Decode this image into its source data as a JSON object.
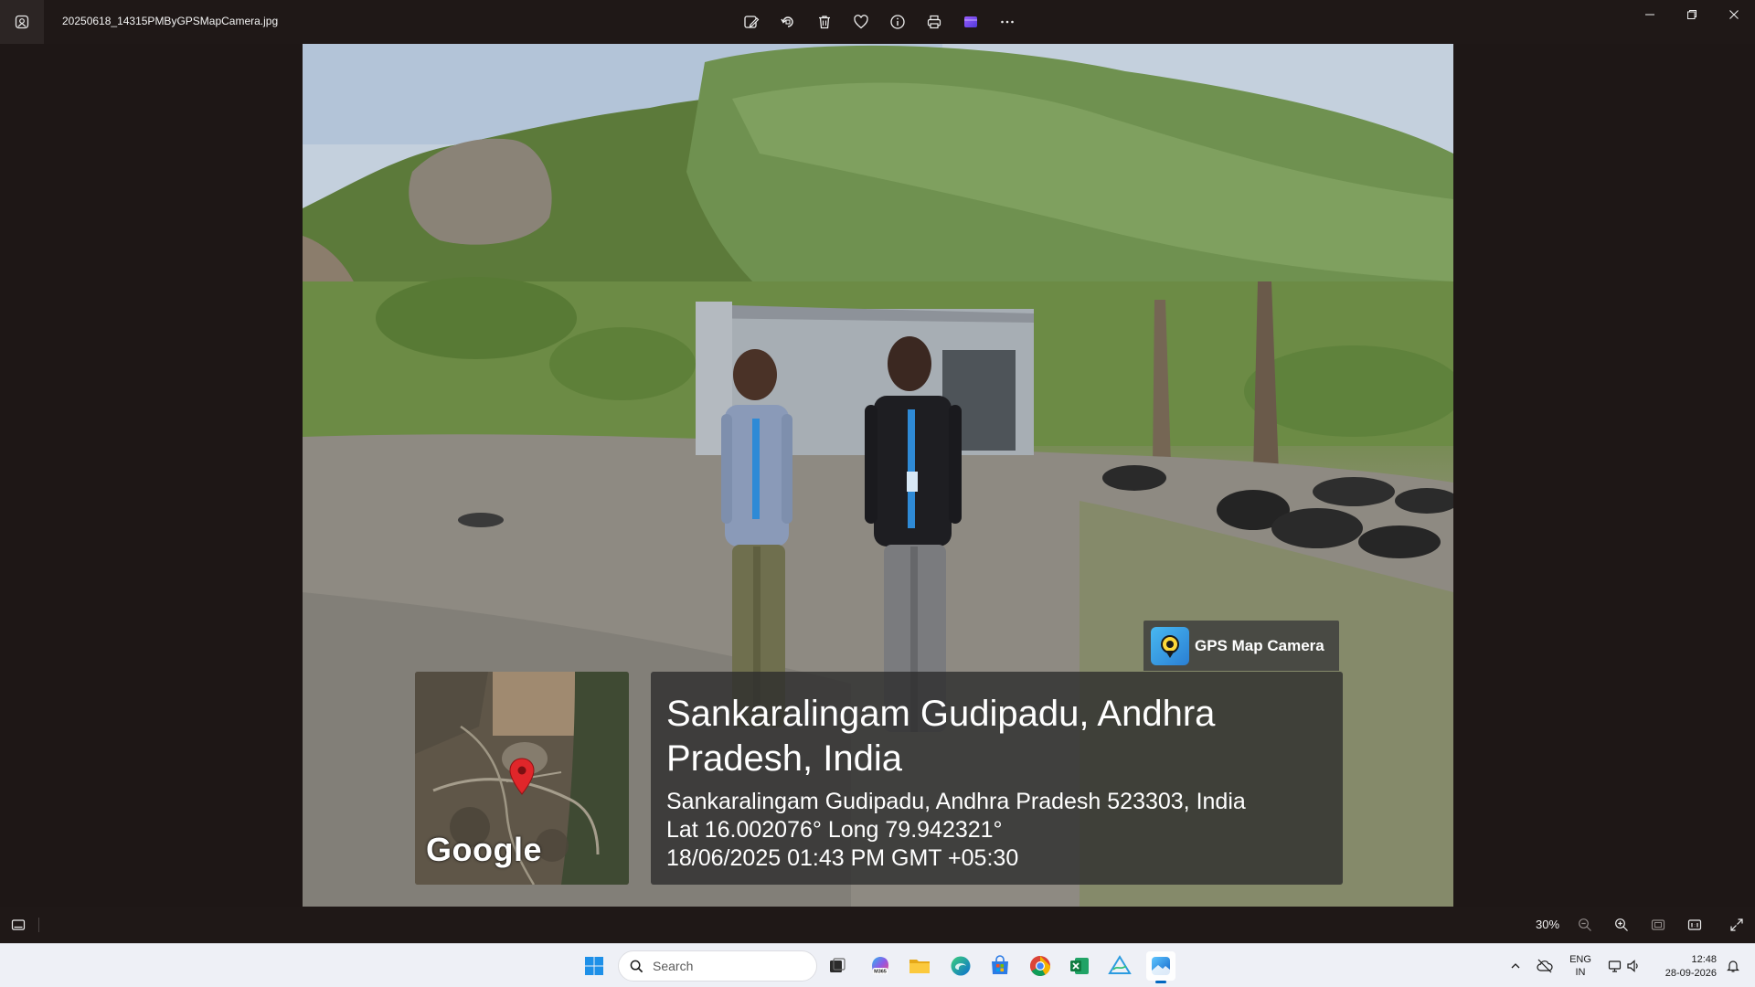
{
  "window": {
    "file_name": "20250618_14315PMByGPSMapCamera.jpg",
    "toolbar_icons": [
      "edit-image-icon",
      "rotate-icon",
      "delete-icon",
      "favorite-icon",
      "info-icon",
      "print-icon",
      "clipchamp-icon",
      "more-icon"
    ],
    "controls": [
      "minimize-icon",
      "restore-icon",
      "close-icon"
    ]
  },
  "photo": {
    "badge_text": "GPS Map Camera",
    "map_logo": "Google",
    "location_title": "Sankaralingam Gudipadu, Andhra Pradesh, India",
    "address": "Sankaralingam Gudipadu, Andhra Pradesh 523303, India",
    "coordinates": "Lat 16.002076° Long 79.942321°",
    "timestamp": "18/06/2025 01:43 PM GMT +05:30"
  },
  "bottombar": {
    "zoom": "30%",
    "icons": [
      "filmstrip-icon",
      "zoom-out-icon",
      "zoom-in-icon",
      "fit-to-window-icon",
      "actual-size-icon",
      "fullscreen-icon"
    ]
  },
  "taskbar": {
    "search_placeholder": "Search",
    "apps": [
      "start-icon",
      "task-view-icon",
      "m365-copilot-icon",
      "file-explorer-icon",
      "edge-icon",
      "store-icon",
      "chrome-icon",
      "excel-icon",
      "sketch-app-icon",
      "photos-icon"
    ],
    "m365_label": "M365",
    "lang_line1": "ENG",
    "lang_line2": "IN",
    "time": "12:48",
    "date": "28-09-2026"
  },
  "colors": {
    "window_bg": "#1e1716",
    "taskbar_bg": "#eef0f6",
    "accent": "#0067c0",
    "map_pin": "#e0262a"
  }
}
